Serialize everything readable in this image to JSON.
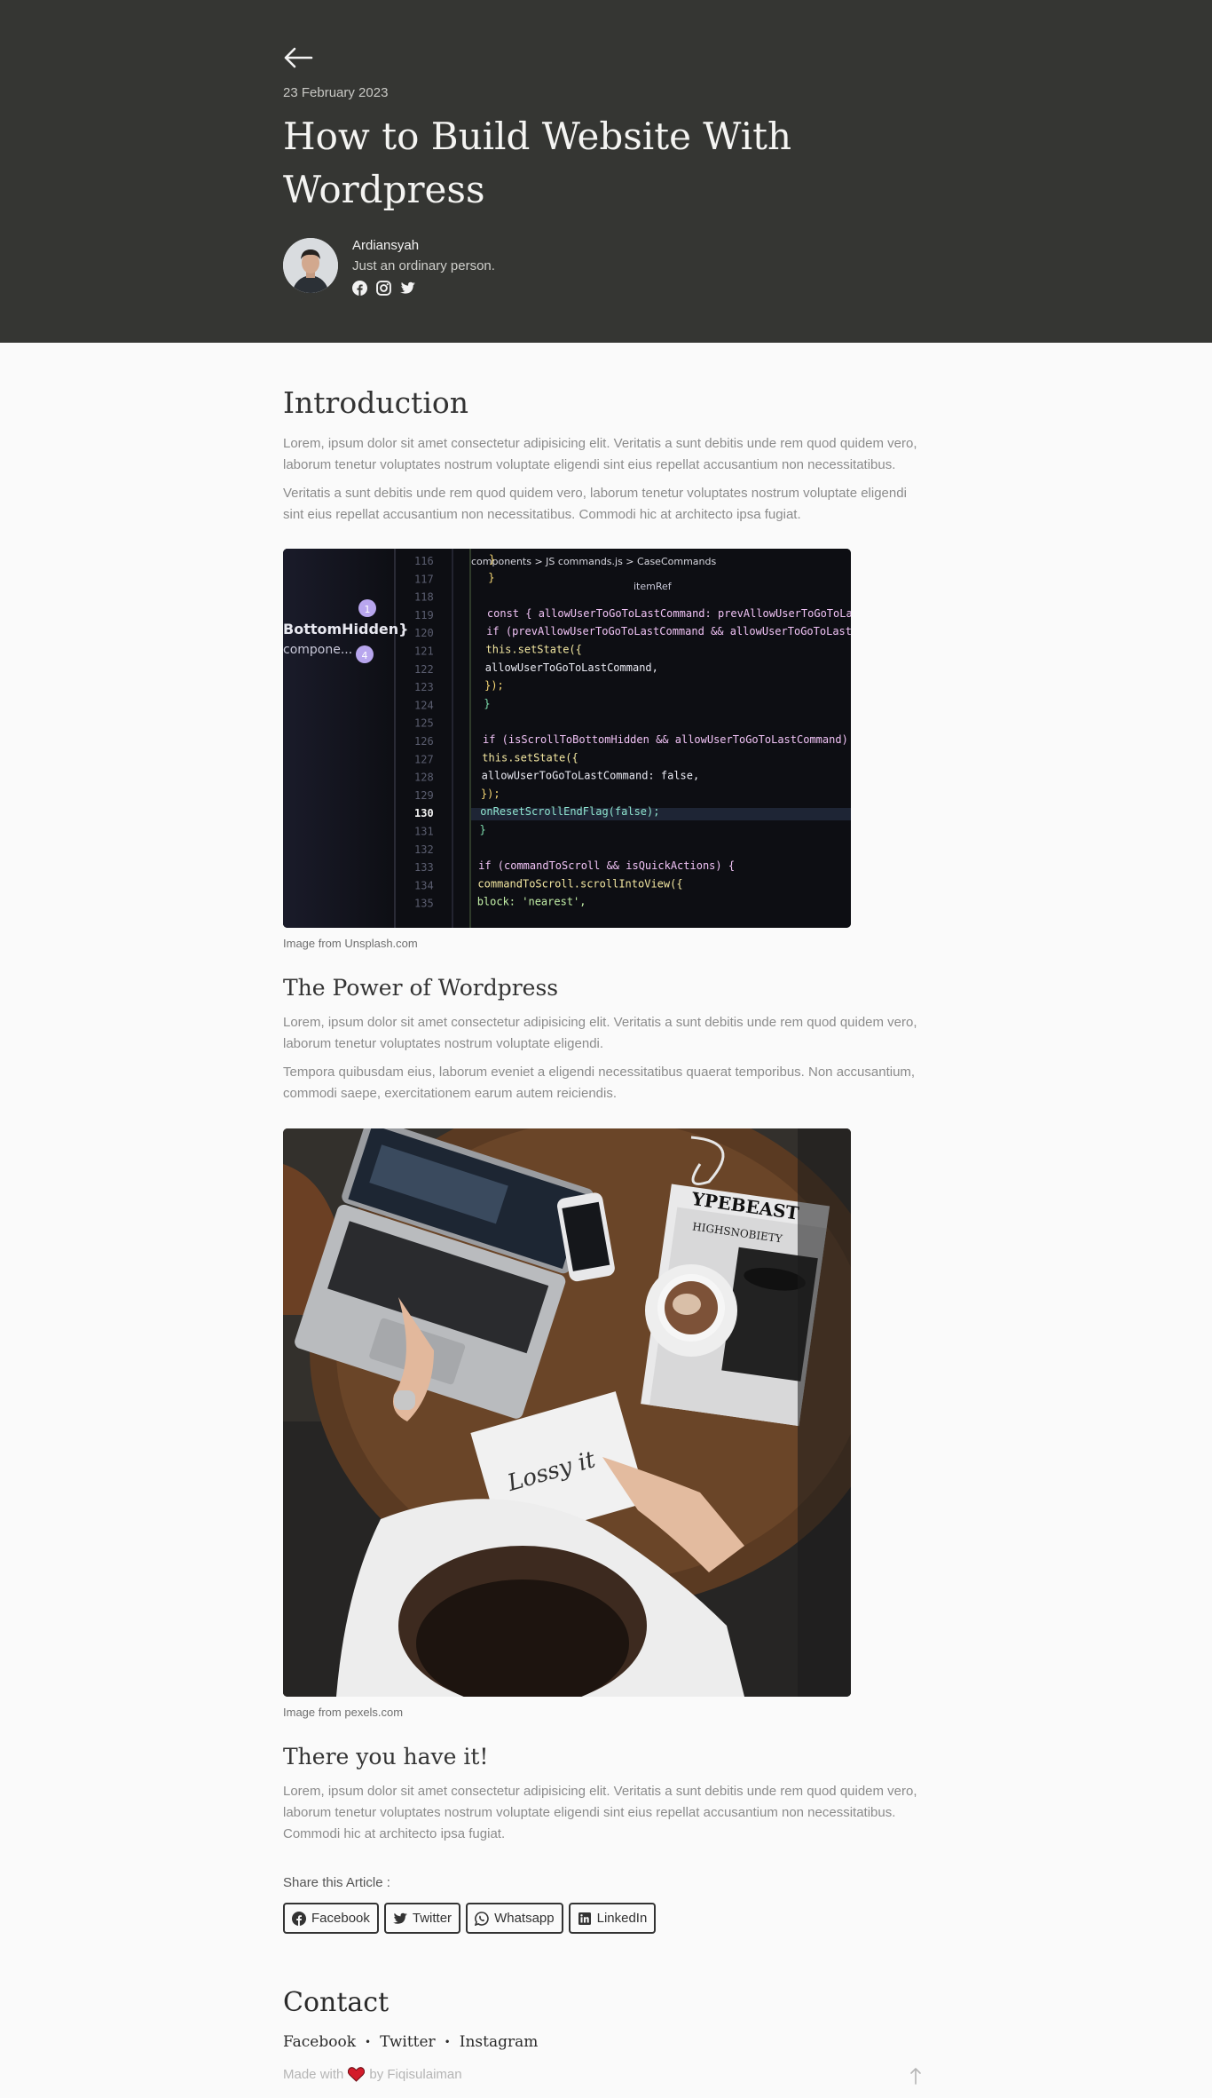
{
  "header": {
    "back_icon": "arrow-left-icon",
    "date": "23 February 2023",
    "title": "How to Build Website With Wordpress",
    "author": {
      "name": "Ardiansyah",
      "bio": "Just an ordinary person.",
      "socials": [
        "facebook-icon",
        "instagram-icon",
        "twitter-icon"
      ]
    }
  },
  "sections": {
    "intro": {
      "heading": "Introduction",
      "p1": "Lorem, ipsum dolor sit amet consectetur adipisicing elit. Veritatis a sunt debitis unde rem quod quidem vero, laborum tenetur voluptates nostrum voluptate eligendi sint eius repellat accusantium non necessitatibus.",
      "p2": "Veritatis a sunt debitis unde rem quod quidem vero, laborum tenetur voluptates nostrum voluptate eligendi sint eius repellat accusantium non necessitatibus. Commodi hic at architecto ipsa fugiat.",
      "caption": "Image from Unsplash.com"
    },
    "power": {
      "heading": "The Power of Wordpress",
      "p1": "Lorem, ipsum dolor sit amet consectetur adipisicing elit. Veritatis a sunt debitis unde rem quod quidem vero, laborum tenetur voluptates nostrum voluptate eligendi.",
      "p2": "Tempora quibusdam eius, laborum eveniet a eligendi necessitatibus quaerat temporibus. Non accusantium, commodi saepe, exercitationem earum autem reiciendis.",
      "caption": "Image from pexels.com"
    },
    "outro": {
      "heading": "There you have it!",
      "p1": "Lorem, ipsum dolor sit amet consectetur adipisicing elit. Veritatis a sunt debitis unde rem quod quidem vero, laborum tenetur voluptates nostrum voluptate eligendi sint eius repellat accusantium non necessitatibus. Commodi hic at architecto ipsa fugiat."
    }
  },
  "code_lines": {
    "numbers": [
      "116",
      "117",
      "118",
      "119",
      "120",
      "121",
      "122",
      "123",
      "124",
      "125",
      "126",
      "127",
      "128",
      "129",
      "130",
      "131",
      "132",
      "133",
      "134",
      "135"
    ],
    "side_labels": [
      "BottomHidden}",
      "compone..."
    ],
    "breadcrumb": "components  >  JS commands.js  >  CaseCommands",
    "item_ref": "itemRef",
    "code": [
      "  }",
      "}",
      "",
      "const { allowUserToGoToLastCommand: prevAllowUserToGoToLastCommand }",
      "if (prevAllowUserToGoToLastCommand && allowUserToGoToLastCommand)",
      "  this.setState({",
      "    allowUserToGoToLastCommand,",
      "  });",
      "}",
      "",
      "if (isScrollToBottomHidden && allowUserToGoToLastCommand) {",
      "  this.setState({",
      "    allowUserToGoToLastCommand: false,",
      "  });",
      "  onResetScrollEndFlag(false);",
      "}",
      "",
      "if (commandToScroll && isQuickActions) {",
      "  commandToScroll.scrollIntoView({",
      "    block: 'nearest',"
    ]
  },
  "photo_text": {
    "magazine": "YPEBEAST",
    "magazine2": "HIGHSNOBIETY",
    "drawing": "Lossy it"
  },
  "share": {
    "label": "Share this Article :",
    "buttons": [
      {
        "label": "Facebook",
        "icon": "facebook-icon"
      },
      {
        "label": "Twitter",
        "icon": "twitter-icon"
      },
      {
        "label": "Whatsapp",
        "icon": "whatsapp-icon"
      },
      {
        "label": "LinkedIn",
        "icon": "linkedin-icon"
      }
    ]
  },
  "footer": {
    "contact_title": "Contact",
    "links": [
      "Facebook",
      "Twitter",
      "Instagram"
    ],
    "made_prefix": "Made with",
    "made_suffix": "by Fiqisulaiman",
    "heart_icon": "heart-icon",
    "up_icon": "arrow-up-icon"
  }
}
